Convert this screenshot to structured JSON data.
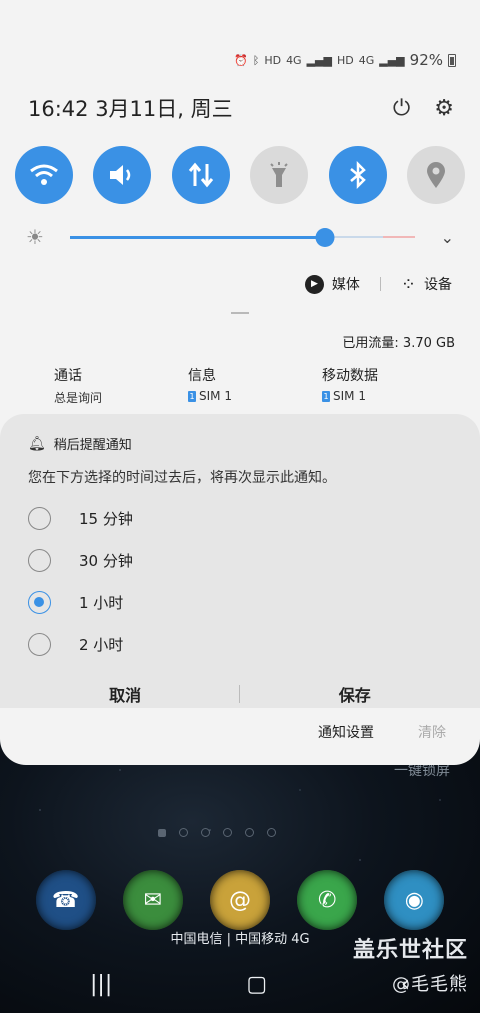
{
  "status_bar": {
    "icons": [
      "alarm-icon",
      "bluetooth-icon",
      "hd-icon",
      "4g-icon",
      "signal-icon",
      "hd-icon",
      "4g-icon",
      "signal-icon"
    ],
    "hd1": "HD",
    "g1": "4G",
    "hd2": "HD",
    "g2": "4G",
    "battery": "92%"
  },
  "header": {
    "datetime": "16:42  3月11日, 周三"
  },
  "quick_settings": [
    {
      "name": "wifi",
      "state": "on"
    },
    {
      "name": "sound",
      "state": "on"
    },
    {
      "name": "mobile-data",
      "state": "on"
    },
    {
      "name": "flashlight",
      "state": "off"
    },
    {
      "name": "bluetooth",
      "state": "on"
    },
    {
      "name": "location",
      "state": "off"
    }
  ],
  "brightness": {
    "level": 0.74
  },
  "media_row": {
    "media_label": "媒体",
    "devices_label": "设备"
  },
  "data_usage": "已用流量: 3.70 GB",
  "sim_settings": [
    {
      "title": "通话",
      "value": "总是询问"
    },
    {
      "title": "信息",
      "badge": "1",
      "value": "SIM 1"
    },
    {
      "title": "移动数据",
      "badge": "1",
      "value": "SIM 1"
    }
  ],
  "snooze": {
    "title": "稍后提醒通知",
    "description": "您在下方选择的时间过去后，将再次显示此通知。",
    "options": [
      {
        "label": "15 分钟",
        "checked": false
      },
      {
        "label": "30 分钟",
        "checked": false
      },
      {
        "label": "1 小时",
        "checked": true
      },
      {
        "label": "2 小时",
        "checked": false
      }
    ],
    "cancel": "取消",
    "save": "保存"
  },
  "footer": {
    "settings": "通知设置",
    "clear": "清除"
  },
  "home": {
    "lock_text": "一键锁屏",
    "carrier": "中国电信 | 中国移动 4G",
    "watermark_title": "盖乐世社区",
    "watermark_user": "@毛毛熊"
  },
  "colors": {
    "accent": "#3a91e5",
    "panel": "#f3f3f3",
    "snooze_card": "#e6e6e6"
  }
}
